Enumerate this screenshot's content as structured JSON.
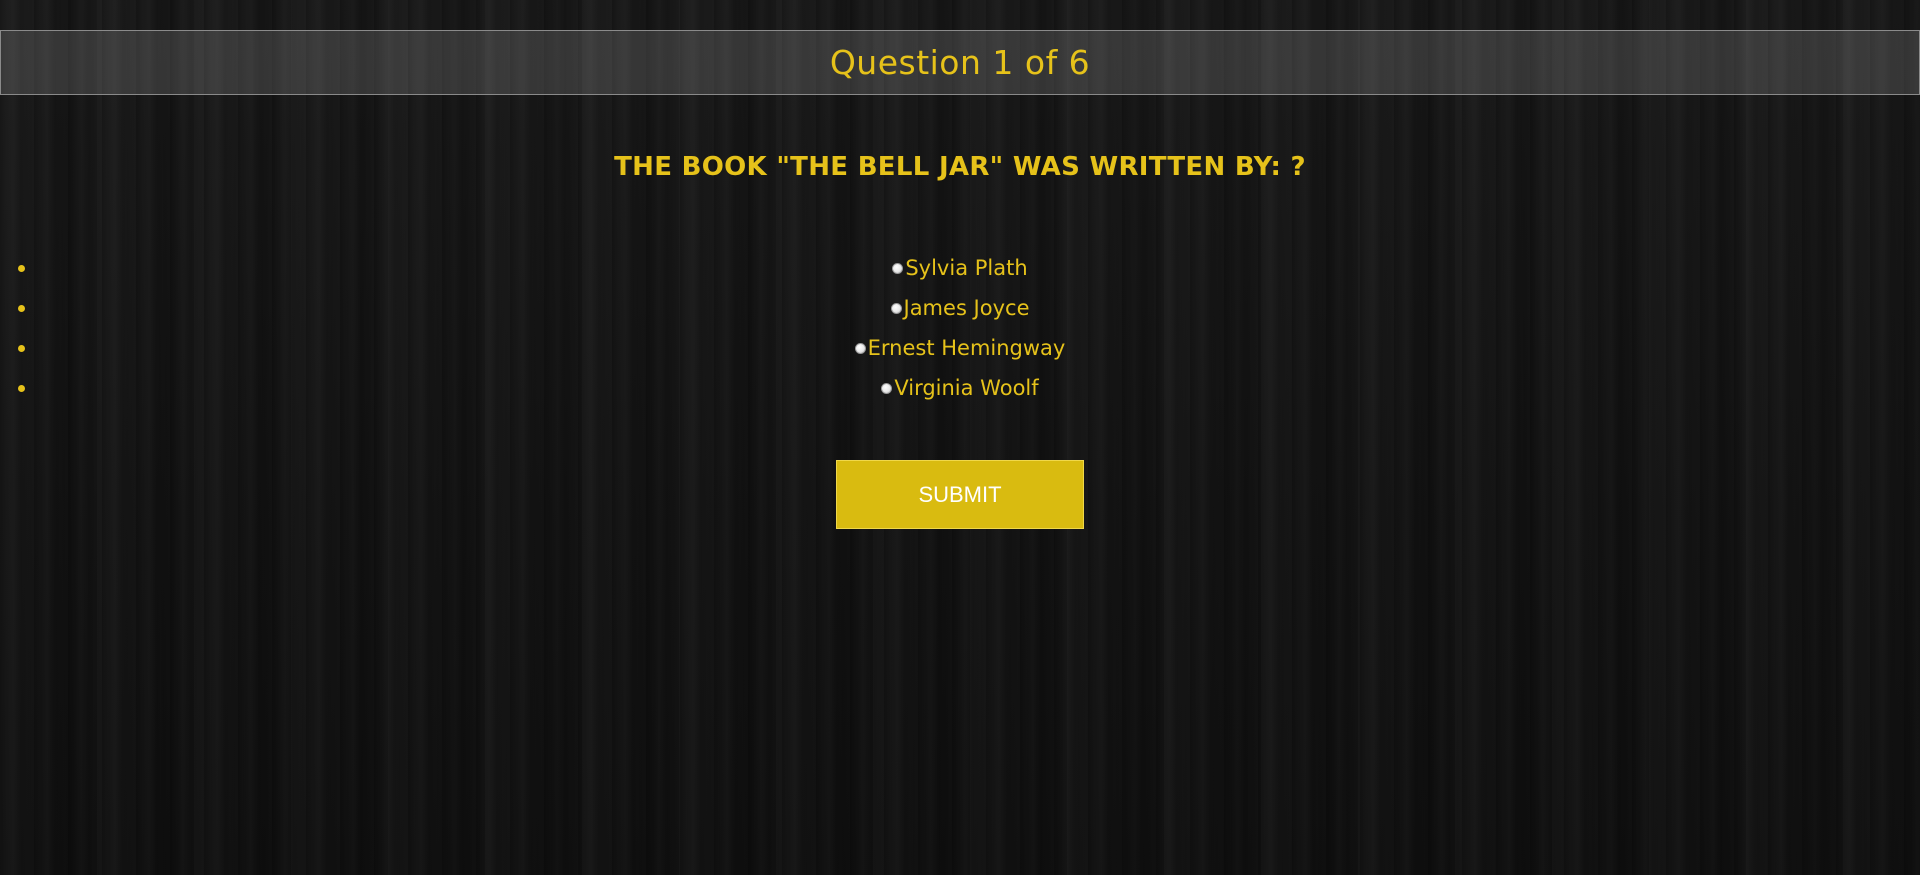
{
  "header": {
    "title": "Question 1 of 6"
  },
  "question": {
    "text": "THE BOOK \"THE BELL JAR\" WAS WRITTEN BY: ?"
  },
  "answers": [
    {
      "label": "Sylvia Plath",
      "selected": false
    },
    {
      "label": "James Joyce",
      "selected": false
    },
    {
      "label": "Ernest Hemingway",
      "selected": false
    },
    {
      "label": "Virginia Woolf",
      "selected": false
    }
  ],
  "submit": {
    "label": "SUBMIT"
  },
  "colors": {
    "accent": "#e6c21a",
    "button": "#d9bb10",
    "background": "#161616"
  }
}
